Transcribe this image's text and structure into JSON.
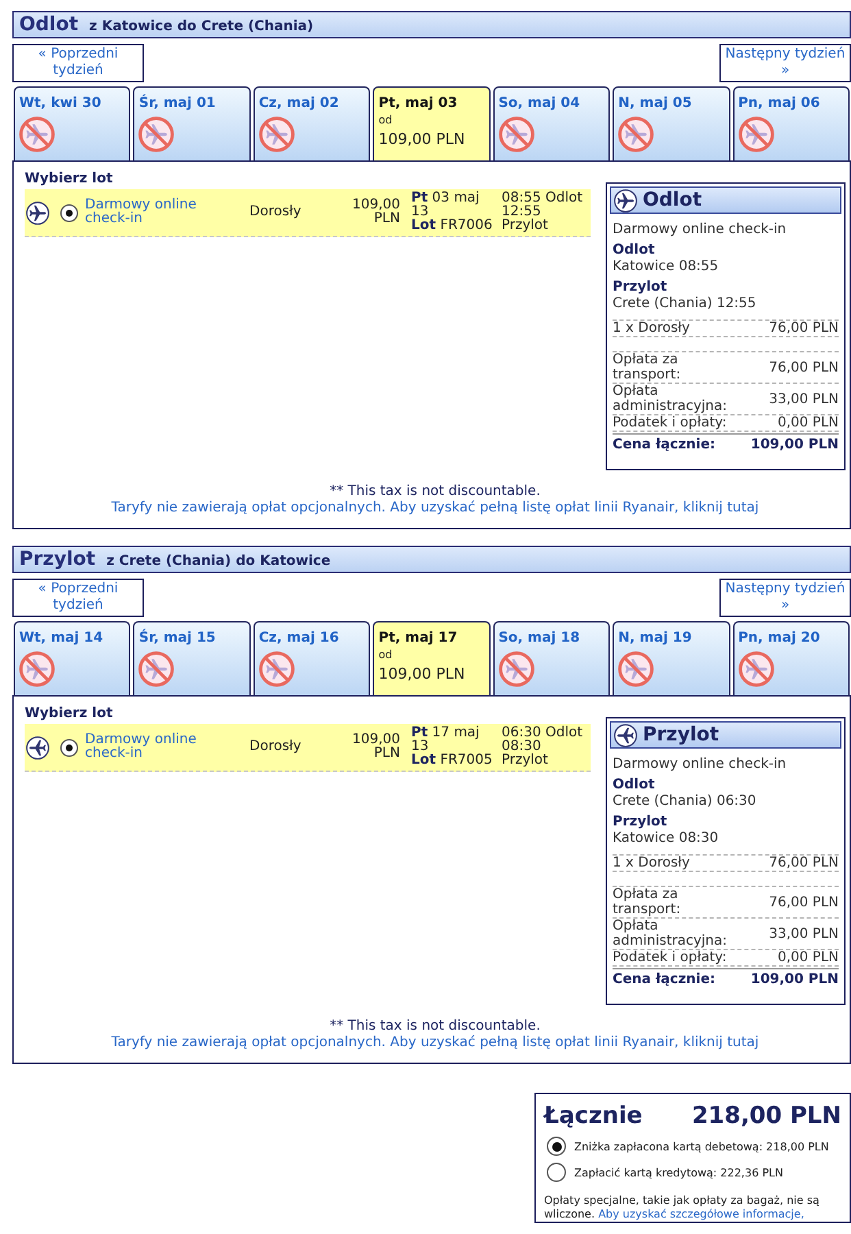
{
  "legs": [
    {
      "kind": "outbound",
      "title": "Odlot",
      "route": "z Katowice do Crete (Chania)",
      "prev_week": "« Poprzedni tydzień",
      "next_week": "Następny tydzień »",
      "days": [
        {
          "label": "Wt, kwi 30",
          "selected": false,
          "available": false
        },
        {
          "label": "Śr, maj 01",
          "selected": false,
          "available": false
        },
        {
          "label": "Cz, maj 02",
          "selected": false,
          "available": false
        },
        {
          "label": "Pt, maj 03",
          "selected": true,
          "available": true,
          "from": "od",
          "price": "109,00 PLN"
        },
        {
          "label": "So, maj 04",
          "selected": false,
          "available": false
        },
        {
          "label": "N, maj 05",
          "selected": false,
          "available": false
        },
        {
          "label": "Pn, maj 06",
          "selected": false,
          "available": false
        }
      ],
      "choose_label": "Wybierz lot",
      "flights": [
        {
          "selected": true,
          "fare": "Darmowy online check-in",
          "passenger": "Dorosły",
          "price": "109,00 PLN",
          "date": "**Pt** 03 maj 13",
          "flight": "**Lot** FR7006",
          "depart": "08:55 Odlot",
          "arrive": "12:55 Przylot"
        }
      ],
      "summary": {
        "title": "Odlot",
        "fare": "Darmowy online check-in",
        "depart_label": "Odlot",
        "depart": "Katowice 08:55",
        "arrive_label": "Przylot",
        "arrive": "Crete (Chania) 12:55",
        "passengers": [
          {
            "label": "1 x Dorosły",
            "amount": "76,00 PLN"
          }
        ],
        "fees": [
          {
            "label": "Opłata za transport:",
            "amount": "76,00 PLN"
          },
          {
            "label": "Opłata administracyjna:",
            "amount": "33,00 PLN"
          },
          {
            "label": "Podatek i opłaty:",
            "amount": "0,00 PLN"
          }
        ],
        "total_label": "Cena łącznie:",
        "total": "109,00 PLN"
      },
      "note": "** This tax is not discountable.",
      "fares_link": "Taryfy nie zawierają opłat opcjonalnych. Aby uzyskać pełną listę opłat linii Ryanair, kliknij tutaj"
    },
    {
      "kind": "inbound",
      "title": "Przylot",
      "route": "z Crete (Chania) do Katowice",
      "prev_week": "« Poprzedni tydzień",
      "next_week": "Następny tydzień »",
      "days": [
        {
          "label": "Wt, maj 14",
          "selected": false,
          "available": false
        },
        {
          "label": "Śr, maj 15",
          "selected": false,
          "available": false
        },
        {
          "label": "Cz, maj 16",
          "selected": false,
          "available": false
        },
        {
          "label": "Pt, maj 17",
          "selected": true,
          "available": true,
          "from": "od",
          "price": "109,00 PLN"
        },
        {
          "label": "So, maj 18",
          "selected": false,
          "available": false
        },
        {
          "label": "N, maj 19",
          "selected": false,
          "available": false
        },
        {
          "label": "Pn, maj 20",
          "selected": false,
          "available": false
        }
      ],
      "choose_label": "Wybierz lot",
      "flights": [
        {
          "selected": true,
          "fare": "Darmowy online check-in",
          "passenger": "Dorosły",
          "price": "109,00 PLN",
          "date": "**Pt** 17 maj 13",
          "flight": "**Lot** FR7005",
          "depart": "06:30 Odlot",
          "arrive": "08:30 Przylot"
        }
      ],
      "summary": {
        "title": "Przylot",
        "fare": "Darmowy online check-in",
        "depart_label": "Odlot",
        "depart": "Crete (Chania) 06:30",
        "arrive_label": "Przylot",
        "arrive": "Katowice 08:30",
        "passengers": [
          {
            "label": "1 x Dorosły",
            "amount": "76,00 PLN"
          }
        ],
        "fees": [
          {
            "label": "Opłata za transport:",
            "amount": "76,00 PLN"
          },
          {
            "label": "Opłata administracyjna:",
            "amount": "33,00 PLN"
          },
          {
            "label": "Podatek i opłaty:",
            "amount": "0,00 PLN"
          }
        ],
        "total_label": "Cena łącznie:",
        "total": "109,00 PLN"
      },
      "note": "** This tax is not discountable.",
      "fares_link": "Taryfy nie zawierają opłat opcjonalnych. Aby uzyskać pełną listę opłat linii Ryanair, kliknij tutaj"
    }
  ],
  "total": {
    "label": "Łącznie",
    "amount": "218,00 PLN",
    "payment_options": [
      {
        "label": "Zniżka zapłacona kartą debetową: 218,00 PLN",
        "selected": true
      },
      {
        "label": "Zapłacić kartą kredytową: 222,36 PLN",
        "selected": false
      }
    ],
    "note": "Opłaty specjalne, takie jak opłaty za bagaż, nie są wliczone.",
    "link": "Aby uzyskać szczegółowe informacje,"
  }
}
